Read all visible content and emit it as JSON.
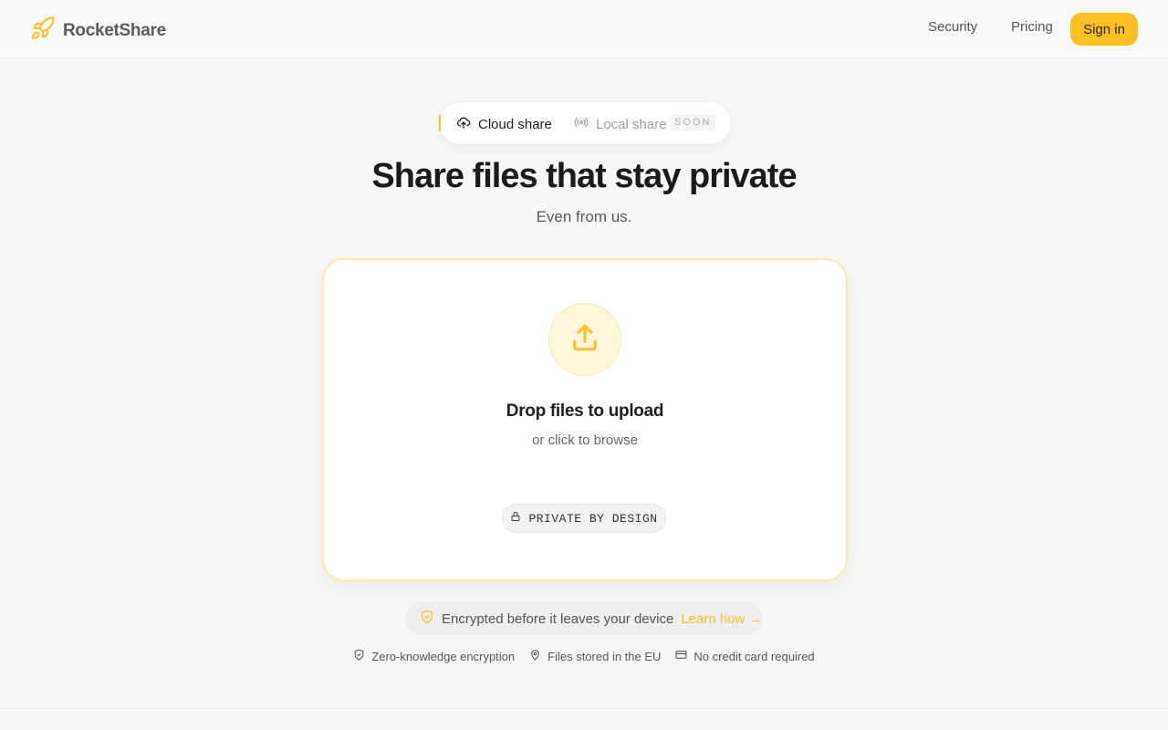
{
  "app": {
    "name": "RocketShare"
  },
  "nav": {
    "security": "Security",
    "pricing": "Pricing",
    "signin": "Sign in"
  },
  "mode": {
    "cloud": "Cloud share",
    "local": "Local share",
    "local_badge": "SOON"
  },
  "hero": {
    "title": "Share files that stay private",
    "subtitle": "Even from us."
  },
  "dropzone": {
    "title": "Drop files to upload",
    "subtitle": "or click to browse",
    "badge": "PRIVATE BY DESIGN"
  },
  "encryption": {
    "text": "Encrypted before it leaves your device",
    "link": "Learn how →"
  },
  "features": [
    {
      "icon": "shield-check-icon",
      "label": "Zero-knowledge encryption"
    },
    {
      "icon": "map-pin-icon",
      "label": "Files stored in the EU"
    },
    {
      "icon": "credit-card-icon",
      "label": "No credit card required"
    }
  ],
  "colors": {
    "accent": "#fbbf24",
    "accent_soft": "#fff6dc",
    "background": "#f8f8f7"
  }
}
